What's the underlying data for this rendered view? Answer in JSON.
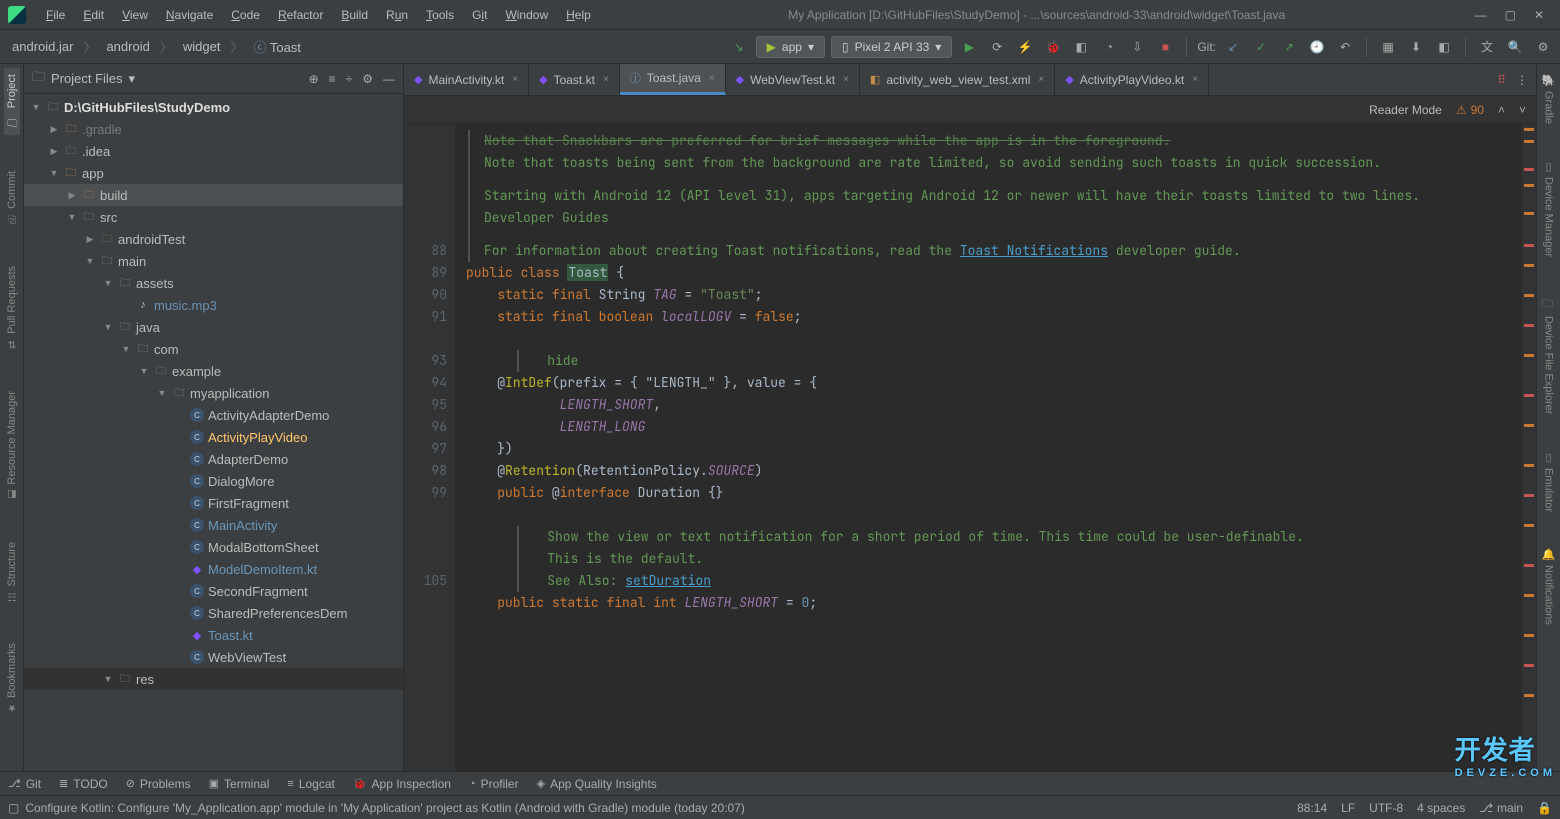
{
  "title": "My Application [D:\\GitHubFiles\\StudyDemo] - ...\\sources\\android-33\\android\\widget\\Toast.java",
  "menu": [
    "File",
    "Edit",
    "View",
    "Navigate",
    "Code",
    "Refactor",
    "Build",
    "Run",
    "Tools",
    "Git",
    "Window",
    "Help"
  ],
  "breadcrumb": [
    "android.jar",
    "android",
    "widget",
    "Toast"
  ],
  "runConfig": "app",
  "device": "Pixel 2 API 33",
  "gitLabel": "Git:",
  "leftRail": [
    "Project",
    "Commit",
    "Pull Requests",
    "Resource Manager",
    "Structure",
    "Bookmarks"
  ],
  "rightRail": [
    "Gradle",
    "Device Manager",
    "Device File Explorer",
    "Emulator",
    "Notifications"
  ],
  "projectHeader": "Project Files",
  "tree": {
    "root": "D:\\GitHubFiles\\StudyDemo",
    "nodes": [
      {
        "indent": 1,
        "chev": "▶",
        "ico": "folder-o",
        "label": ".gradle",
        "dim": true
      },
      {
        "indent": 1,
        "chev": "▶",
        "ico": "folder",
        "label": ".idea"
      },
      {
        "indent": 1,
        "chev": "▼",
        "ico": "folder-o",
        "label": "app"
      },
      {
        "indent": 2,
        "chev": "▶",
        "ico": "folder-o",
        "label": "build",
        "active": true,
        "sel": true
      },
      {
        "indent": 2,
        "chev": "▼",
        "ico": "folder",
        "label": "src"
      },
      {
        "indent": 3,
        "chev": "▶",
        "ico": "folder-g",
        "label": "androidTest"
      },
      {
        "indent": 3,
        "chev": "▼",
        "ico": "folder",
        "label": "main"
      },
      {
        "indent": 4,
        "chev": "▼",
        "ico": "folder",
        "label": "assets"
      },
      {
        "indent": 5,
        "chev": "",
        "ico": "file",
        "label": "music.mp3",
        "color": "#6a8fb5"
      },
      {
        "indent": 4,
        "chev": "▼",
        "ico": "folder",
        "label": "java"
      },
      {
        "indent": 5,
        "chev": "▼",
        "ico": "folder",
        "label": "com"
      },
      {
        "indent": 6,
        "chev": "▼",
        "ico": "folder",
        "label": "example"
      },
      {
        "indent": 7,
        "chev": "▼",
        "ico": "folder",
        "label": "myapplication"
      },
      {
        "indent": 8,
        "chev": "",
        "ico": "cls",
        "label": "ActivityAdapterDemo"
      },
      {
        "indent": 8,
        "chev": "",
        "ico": "cls",
        "label": "ActivityPlayVideo",
        "color": "#ffc66d"
      },
      {
        "indent": 8,
        "chev": "",
        "ico": "cls",
        "label": "AdapterDemo"
      },
      {
        "indent": 8,
        "chev": "",
        "ico": "cls",
        "label": "DialogMore"
      },
      {
        "indent": 8,
        "chev": "",
        "ico": "cls",
        "label": "FirstFragment"
      },
      {
        "indent": 8,
        "chev": "",
        "ico": "cls",
        "label": "MainActivity",
        "color": "#6897bb"
      },
      {
        "indent": 8,
        "chev": "",
        "ico": "cls",
        "label": "ModalBottomSheet"
      },
      {
        "indent": 8,
        "chev": "",
        "ico": "kt",
        "label": "ModelDemoItem.kt",
        "color": "#6897bb"
      },
      {
        "indent": 8,
        "chev": "",
        "ico": "cls",
        "label": "SecondFragment"
      },
      {
        "indent": 8,
        "chev": "",
        "ico": "cls",
        "label": "SharedPreferencesDem"
      },
      {
        "indent": 8,
        "chev": "",
        "ico": "kt",
        "label": "Toast.kt",
        "color": "#6897bb"
      },
      {
        "indent": 8,
        "chev": "",
        "ico": "cls",
        "label": "WebViewTest"
      },
      {
        "indent": 4,
        "chev": "▼",
        "ico": "folder",
        "label": "res",
        "res": true
      }
    ]
  },
  "tabs": [
    {
      "icon": "kt",
      "label": "MainActivity.kt"
    },
    {
      "icon": "kt",
      "label": "Toast.kt"
    },
    {
      "icon": "java",
      "label": "Toast.java",
      "active": true
    },
    {
      "icon": "kt",
      "label": "WebViewTest.kt"
    },
    {
      "icon": "xml",
      "label": "activity_web_view_test.xml"
    },
    {
      "icon": "kt",
      "label": "ActivityPlayVideo.kt"
    }
  ],
  "readerMode": "Reader Mode",
  "warnings": "90",
  "gutterLines": [
    "",
    "",
    "",
    "",
    "",
    "88",
    "89",
    "90",
    "91",
    "",
    "93",
    "94",
    "95",
    "96",
    "97",
    "98",
    "99",
    "",
    "",
    "",
    "105"
  ],
  "doc": {
    "l1": "Note that Snackbars are preferred for brief messages while the app is in the foreground.",
    "l2": "Note that toasts being sent from the background are rate limited, so avoid sending such toasts in quick succession.",
    "l3a": "Starting with Android 12 (API level 31), apps targeting Android 12 or newer will have their toasts limited to two lines.",
    "dev": "Developer Guides",
    "l4a": "For information about creating Toast notifications, read the ",
    "l4link": "Toast Notifications",
    "l4b": " developer guide."
  },
  "code": {
    "cls_line": {
      "pub": "public",
      "cls": "class",
      "name": "Toast"
    },
    "tag_line": {
      "s": "static",
      "f": "final",
      "t": "String",
      "id": "TAG",
      "eq": "=",
      "val": "\"Toast\""
    },
    "logv_line": {
      "s": "static",
      "f": "final",
      "t": "boolean",
      "id": "localLOGV",
      "eq": "=",
      "val": "false"
    },
    "hide_hint": "hide",
    "intdef": {
      "at": "@",
      "ann": "IntDef",
      "args": "(prefix = { \"LENGTH_\" }, value = {"
    },
    "len_short": "LENGTH_SHORT",
    "len_long": "LENGTH_LONG",
    "close_brace": "})",
    "retention": {
      "at": "@",
      "ann": "Retention",
      "args": "(RetentionPolicy.",
      "src": "SOURCE",
      "end": ")"
    },
    "dur_line": {
      "pub": "public",
      "at": "@",
      "intf": "interface",
      "name": "Duration"
    },
    "doc2a": "Show the view or text notification for a short period of time. This time could be user-definable.",
    "doc2b": "This is the default.",
    "see": "See Also: ",
    "seelink": "setDuration",
    "const_line": {
      "pub": "public",
      "s": "static",
      "f": "final",
      "t": "int",
      "id": "LENGTH_SHORT",
      "eq": "=",
      "val": "0"
    }
  },
  "bottomBar": [
    "Git",
    "TODO",
    "Problems",
    "Terminal",
    "Logcat",
    "App Inspection",
    "Profiler",
    "App Quality Insights"
  ],
  "status": {
    "msg": "Configure Kotlin: Configure 'My_Application.app' module in 'My Application' project as Kotlin (Android with Gradle) module (today 20:07)",
    "pos": "88:14",
    "lf": "LF",
    "enc": "UTF-8",
    "indent": "4 spaces",
    "branch": "main"
  },
  "watermark": {
    "t": "开发者",
    "s": "DEVZE.COM"
  }
}
